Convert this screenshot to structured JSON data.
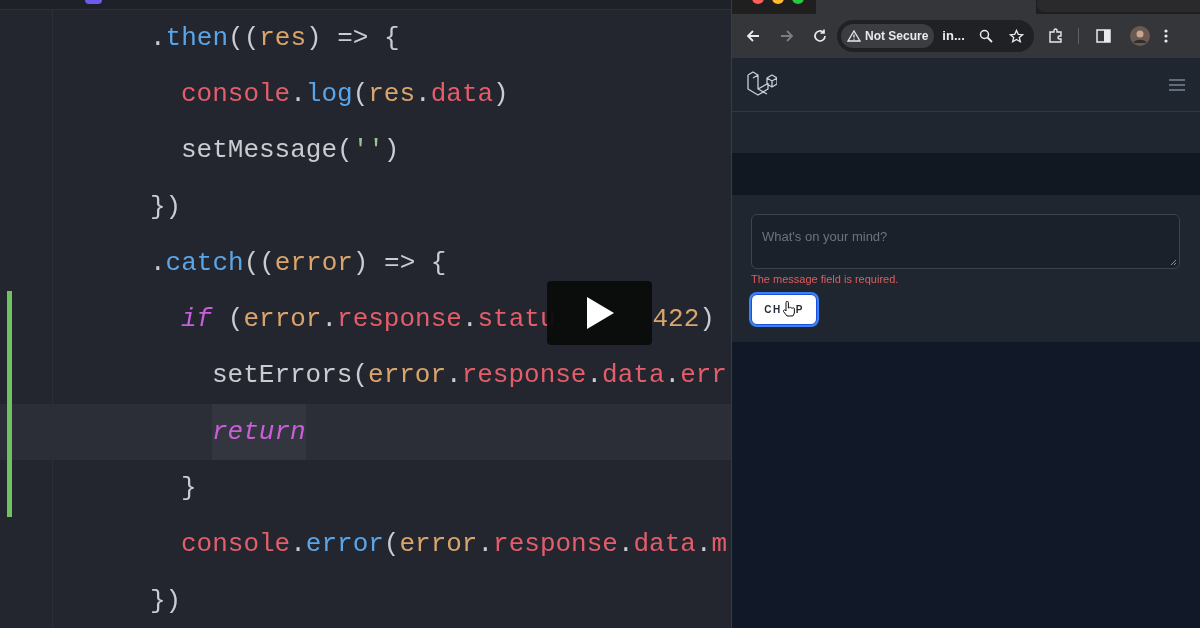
{
  "editor": {
    "lines": [
      {
        "changed": false,
        "current": false,
        "segments": [
          [
            {
              "text": ".",
              "kind": "plain"
            },
            {
              "text": "then",
              "kind": "method"
            },
            {
              "text": "((",
              "kind": "plain"
            },
            {
              "text": "res",
              "kind": "param"
            },
            {
              "text": ") => {",
              "kind": "plain"
            }
          ]
        ],
        "children": [
          {
            "changed": false,
            "current": false,
            "segments": [
              [
                {
                  "text": "console",
                  "kind": "prop"
                },
                {
                  "text": ".",
                  "kind": "plain"
                },
                {
                  "text": "log",
                  "kind": "method"
                },
                {
                  "text": "(",
                  "kind": "plain"
                },
                {
                  "text": "res",
                  "kind": "param"
                },
                {
                  "text": ".",
                  "kind": "plain"
                },
                {
                  "text": "data",
                  "kind": "prop"
                },
                {
                  "text": ")",
                  "kind": "plain"
                }
              ]
            ]
          },
          {
            "changed": false,
            "current": false,
            "segments": [
              [
                {
                  "text": "setMessage(",
                  "kind": "plain"
                },
                {
                  "text": "''",
                  "kind": "string"
                },
                {
                  "text": ")",
                  "kind": "plain"
                }
              ]
            ]
          }
        ]
      },
      {
        "changed": false,
        "current": false,
        "segments": [
          [
            {
              "text": "})",
              "kind": "plain"
            }
          ]
        ]
      },
      {
        "changed": false,
        "current": false,
        "segments": [
          [
            {
              "text": ".",
              "kind": "plain"
            },
            {
              "text": "catch",
              "kind": "method"
            },
            {
              "text": "((",
              "kind": "plain"
            },
            {
              "text": "error",
              "kind": "param"
            },
            {
              "text": ") => {",
              "kind": "plain"
            }
          ]
        ],
        "children": [
          {
            "changed": true,
            "current": false,
            "segments": [
              [
                {
                  "text": "if",
                  "kind": "keyword"
                },
                {
                  "text": " (",
                  "kind": "plain"
                },
                {
                  "text": "error",
                  "kind": "param"
                },
                {
                  "text": ".",
                  "kind": "plain"
                },
                {
                  "text": "response",
                  "kind": "prop"
                },
                {
                  "text": ".",
                  "kind": "plain"
                },
                {
                  "text": "statu",
                  "kind": "prop"
                }
              ],
              [
                {
                  "text": "422",
                  "kind": "number"
                },
                {
                  "text": ")",
                  "kind": "plain"
                }
              ]
            ],
            "children": [
              {
                "changed": true,
                "current": false,
                "segments": [
                  [
                    {
                      "text": "setErrors(",
                      "kind": "plain"
                    },
                    {
                      "text": "error",
                      "kind": "param"
                    },
                    {
                      "text": ".",
                      "kind": "plain"
                    },
                    {
                      "text": "response",
                      "kind": "prop"
                    },
                    {
                      "text": ".",
                      "kind": "plain"
                    },
                    {
                      "text": "data",
                      "kind": "prop"
                    },
                    {
                      "text": ".",
                      "kind": "plain"
                    },
                    {
                      "text": "err",
                      "kind": "prop"
                    }
                  ]
                ]
              },
              {
                "changed": true,
                "current": true,
                "segments": [
                  [
                    {
                      "text": "return",
                      "kind": "keyword"
                    }
                  ]
                ]
              }
            ]
          },
          {
            "changed": true,
            "current": false,
            "segments": [
              [
                {
                  "text": "}",
                  "kind": "plain"
                }
              ]
            ]
          },
          {
            "changed": false,
            "current": false,
            "segments": [
              [
                {
                  "text": "console",
                  "kind": "prop"
                },
                {
                  "text": ".",
                  "kind": "plain"
                },
                {
                  "text": "error",
                  "kind": "method"
                },
                {
                  "text": "(",
                  "kind": "plain"
                },
                {
                  "text": "error",
                  "kind": "param"
                },
                {
                  "text": ".",
                  "kind": "plain"
                },
                {
                  "text": "response",
                  "kind": "prop"
                },
                {
                  "text": ".",
                  "kind": "plain"
                },
                {
                  "text": "data",
                  "kind": "prop"
                },
                {
                  "text": ".",
                  "kind": "plain"
                },
                {
                  "text": "m",
                  "kind": "prop"
                }
              ]
            ]
          }
        ]
      },
      {
        "changed": false,
        "current": false,
        "segments": [
          [
            {
              "text": "})",
              "kind": "plain"
            }
          ]
        ]
      }
    ]
  },
  "browser": {
    "toolbar": {
      "security_label": "Not Secure",
      "address": "in..."
    },
    "page": {
      "form": {
        "placeholder": "What's on your mind?",
        "error": "The message field is required.",
        "button": {
          "label_parts": [
            "CH",
            "P"
          ],
          "focused": true
        }
      }
    }
  }
}
